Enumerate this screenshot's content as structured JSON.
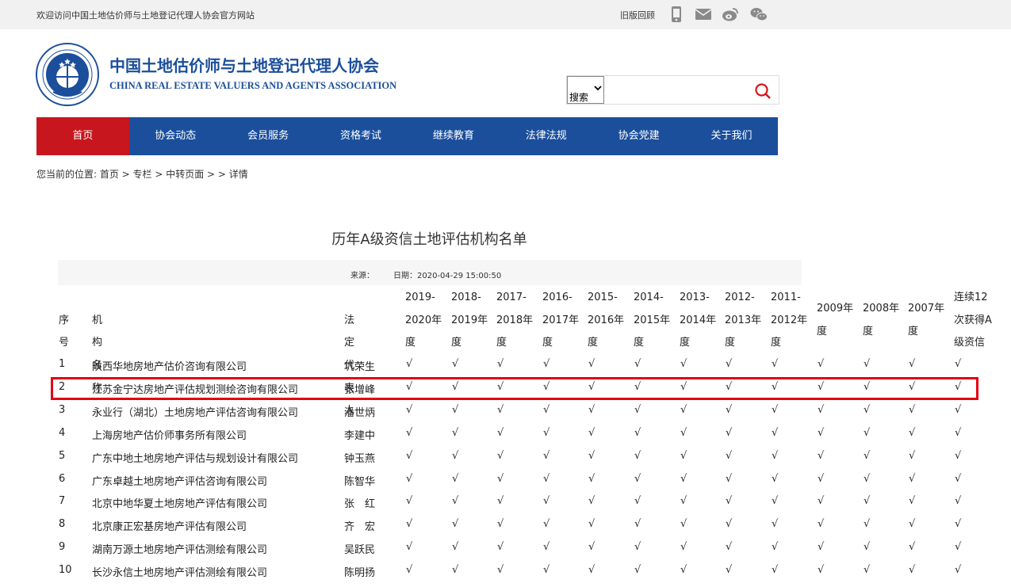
{
  "top": {
    "welcome": "欢迎访问中国土地估价师与土地登记代理人协会官方网站",
    "old_version": "旧版回顾"
  },
  "brand": {
    "cn": "中国土地估价师与土地登记代理人协会",
    "en": "CHINA REAL ESTATE VALUERS AND AGENTS ASSOCIATION"
  },
  "search": {
    "select_label": "搜索",
    "input_value": ""
  },
  "nav": [
    "首页",
    "协会动态",
    "会员服务",
    "资格考试",
    "继续教育",
    "法律法规",
    "协会党建",
    "关于我们"
  ],
  "breadcrumb": "您当前的位置: 首页 > 专栏 > 中转页面 > > 详情",
  "article": {
    "title": "历年A级资信土地评估机构名单",
    "source_label": "来源：",
    "date_label": "日期：2020-04-29 15:00:50"
  },
  "table": {
    "headers": {
      "no": "序号",
      "name": "机构名称",
      "rep": "法定代表人",
      "years": [
        [
          "2019-",
          "2020年",
          "度"
        ],
        [
          "2018-",
          "2019年",
          "度"
        ],
        [
          "2017-",
          "2018年",
          "度"
        ],
        [
          "2016-",
          "2017年",
          "度"
        ],
        [
          "2015-",
          "2016年",
          "度"
        ],
        [
          "2014-",
          "2015年",
          "度"
        ],
        [
          "2013-",
          "2014年",
          "度"
        ],
        [
          "2012-",
          "2013年",
          "度"
        ],
        [
          "2011-",
          "2012年",
          "度"
        ],
        [
          "2009年",
          "度"
        ],
        [
          "2008年",
          "度"
        ],
        [
          "2007年",
          "度"
        ],
        [
          "连续12",
          "次获得A",
          "级资信"
        ]
      ]
    },
    "check": "√",
    "rows": [
      {
        "no": "1",
        "name": "陕西华地房地产估价咨询有限公司",
        "rep": "巩荣生"
      },
      {
        "no": "2",
        "name": "江苏金宁达房地产评估规划测绘咨询有限公司",
        "rep": "张增峰"
      },
      {
        "no": "3",
        "name": "永业行（湖北）土地房地产评估咨询有限公司",
        "rep": "潘世炳"
      },
      {
        "no": "4",
        "name": "上海房地产估价师事务所有限公司",
        "rep": "李建中"
      },
      {
        "no": "5",
        "name": "广东中地土地房地产评估与规划设计有限公司",
        "rep": "钟玉燕"
      },
      {
        "no": "6",
        "name": "广东卓越土地房地产评估咨询有限公司",
        "rep": "陈智华"
      },
      {
        "no": "7",
        "name": "北京中地华夏土地房地产评估有限公司",
        "rep": "张　红"
      },
      {
        "no": "8",
        "name": "北京康正宏基房地产评估有限公司",
        "rep": "齐　宏"
      },
      {
        "no": "9",
        "name": "湖南万源土地房地产评估测绘有限公司",
        "rep": "吴跃民"
      },
      {
        "no": "10",
        "name": "长沙永信土地房地产评估测绘有限公司",
        "rep": "陈明扬"
      }
    ],
    "highlighted_row": 2
  },
  "colors": {
    "nav_blue": "#1b4f9c",
    "nav_active_red": "#c7161d",
    "brand_blue": "#1b4e9b",
    "highlight_red": "#e60012"
  }
}
